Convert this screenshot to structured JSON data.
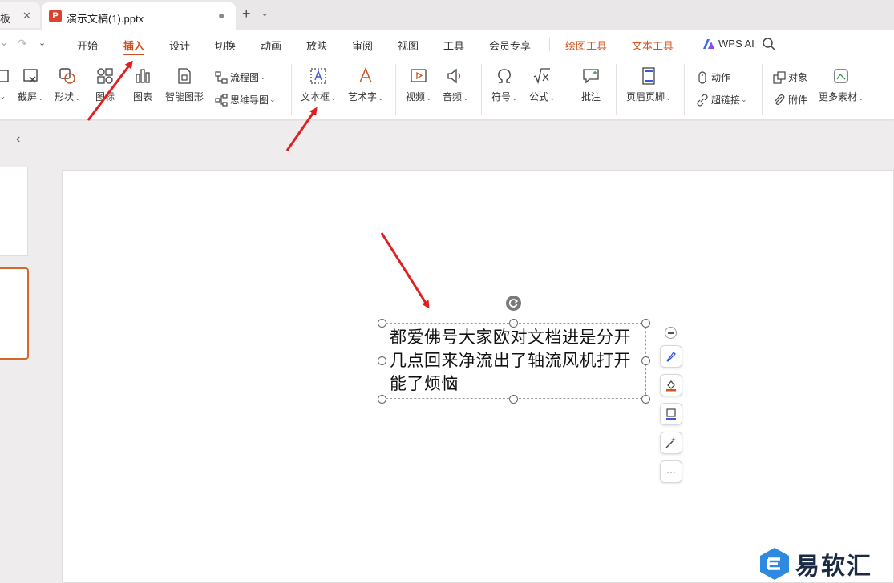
{
  "tabs": {
    "previous_tab_label": "板",
    "active_tab_label": "演示文稿(1).pptx",
    "app_badge": "P"
  },
  "menu": {
    "items": [
      "开始",
      "插入",
      "设计",
      "切换",
      "动画",
      "放映",
      "审阅",
      "视图",
      "工具",
      "会员专享"
    ],
    "active": "插入",
    "context_tabs": [
      "绘图工具",
      "文本工具"
    ],
    "wps_ai_label": "WPS AI"
  },
  "ribbon": {
    "screenshot_label": "截屏",
    "shape_label": "形状",
    "icon_label": "图标",
    "chart_label": "图表",
    "smartart_label": "智能图形",
    "flowchart_label": "流程图",
    "mindmap_label": "思维导图",
    "textbox_label": "文本框",
    "wordart_label": "艺术字",
    "video_label": "视频",
    "audio_label": "音频",
    "symbol_label": "符号",
    "formula_label": "公式",
    "comment_label": "批注",
    "header_footer_label": "页眉页脚",
    "action_label": "动作",
    "hyperlink_label": "超链接",
    "object_label": "对象",
    "attachment_label": "附件",
    "more_material_label": "更多素材"
  },
  "slide": {
    "textbox_text": "都爱佛号大家欧对文档进是分开几点回来净流出了轴流风机打开能了烦恼"
  },
  "watermark": {
    "text": "易软汇"
  },
  "colors": {
    "accent": "#c7511f",
    "arrow": "#e02020",
    "ppt_badge": "#d9432f"
  }
}
